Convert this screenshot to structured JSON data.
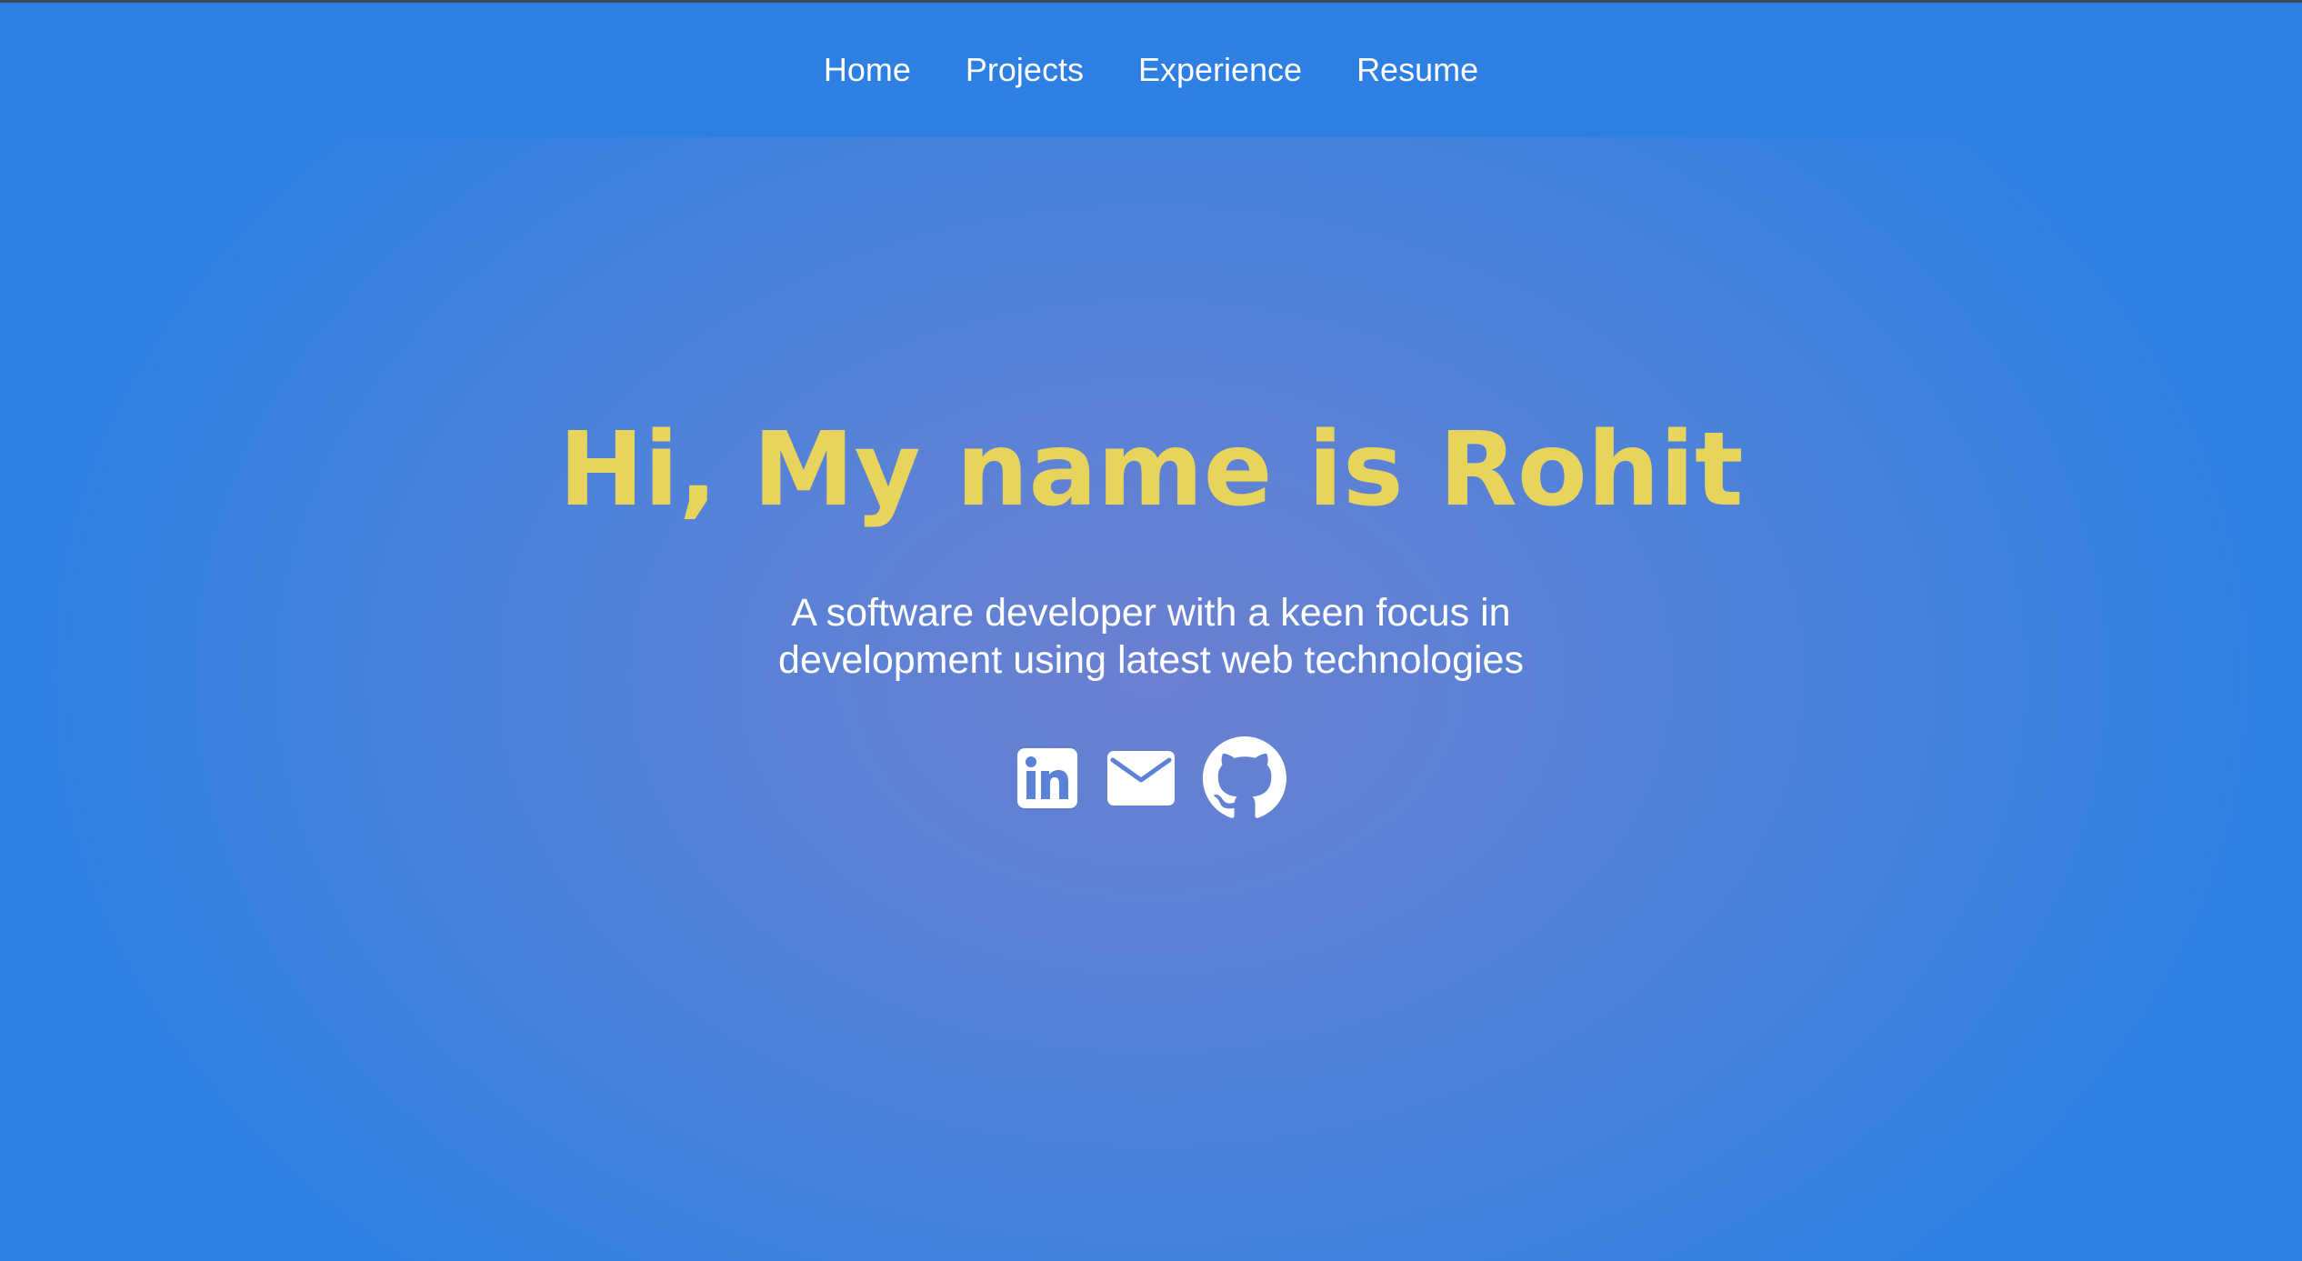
{
  "nav": {
    "items": [
      {
        "label": "Home"
      },
      {
        "label": "Projects"
      },
      {
        "label": "Experience"
      },
      {
        "label": "Resume"
      }
    ]
  },
  "hero": {
    "title": "Hi, My name is Rohit",
    "subtitle": "A software developer with a keen focus in development using latest web technologies"
  },
  "social": [
    {
      "icon": "linkedin-icon"
    },
    {
      "icon": "mail-icon"
    },
    {
      "icon": "github-icon"
    }
  ],
  "colors": {
    "background": "#2e7fe2",
    "title": "#e8d35c",
    "text": "#ffffff"
  }
}
